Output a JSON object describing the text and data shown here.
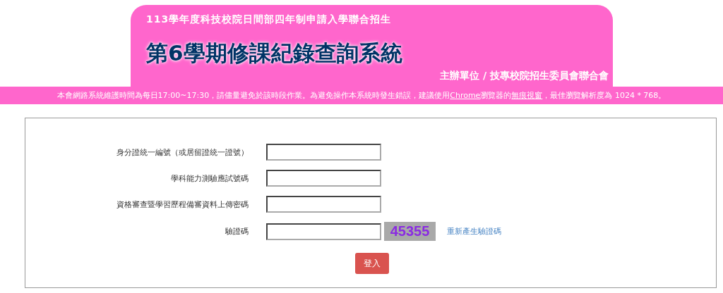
{
  "header": {
    "subtitle": "113學年度科技校院日間部四年制申請入學聯合招生",
    "title": "第6學期修課紀錄查詢系統",
    "organizer": "主辦單位 / 技專校院招生委員會聯合會"
  },
  "notice": [
    {
      "kind": "text",
      "text": "本會網路系統維護時間為每日17:00~17:30，請儘量避免於該時段作業。為避免操作本系統時發生錯誤，建議使用"
    },
    {
      "kind": "link",
      "text": "Chrome"
    },
    {
      "kind": "text",
      "text": "瀏覽器的"
    },
    {
      "kind": "link",
      "text": "無痕視窗"
    },
    {
      "kind": "text",
      "text": "，最佳瀏覽解析度為 1024 * 768。"
    }
  ],
  "form": {
    "fields": [
      {
        "label": "身分證統一編號（或居留證統一證號）"
      },
      {
        "label": "學科能力測驗應試號碼"
      },
      {
        "label": "資格審查暨學習歷程備審資料上傳密碼"
      },
      {
        "label": "驗證碼",
        "captcha": "45355",
        "refresh_link": "重新產生驗證碼"
      }
    ],
    "submit": "登入"
  }
}
